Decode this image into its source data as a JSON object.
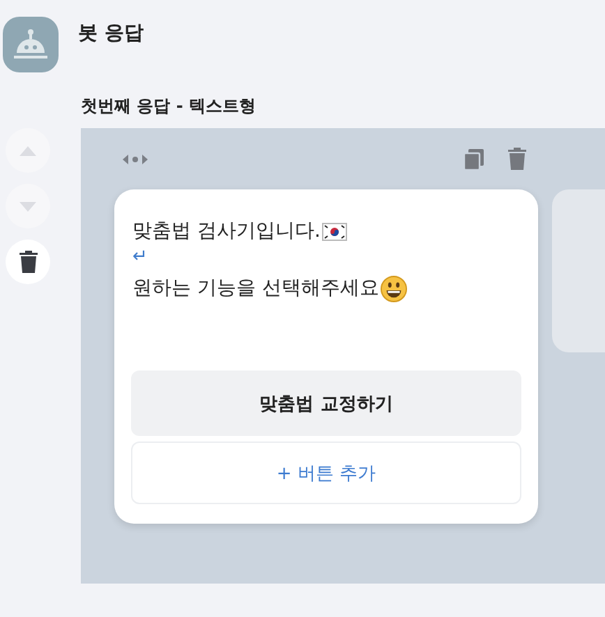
{
  "header": {
    "title": "봇 응답"
  },
  "response": {
    "title": "첫번째 응답 - 텍스트형"
  },
  "side_controls": [
    {
      "kind": "up",
      "disabled": true
    },
    {
      "kind": "down",
      "disabled": true
    },
    {
      "kind": "delete",
      "disabled": false
    }
  ],
  "card": {
    "lines": [
      {
        "kind": "flag-text",
        "text": "맞춤법 검사기입니다."
      },
      {
        "kind": "break",
        "text": "↵"
      },
      {
        "kind": "smiley-text",
        "text": "원하는 기능을 선택해주세요"
      }
    ],
    "buttons": [
      {
        "kind": "action",
        "label": "맞춤법 교정하기"
      },
      {
        "kind": "add",
        "label": "+ 버튼 추가"
      }
    ]
  }
}
